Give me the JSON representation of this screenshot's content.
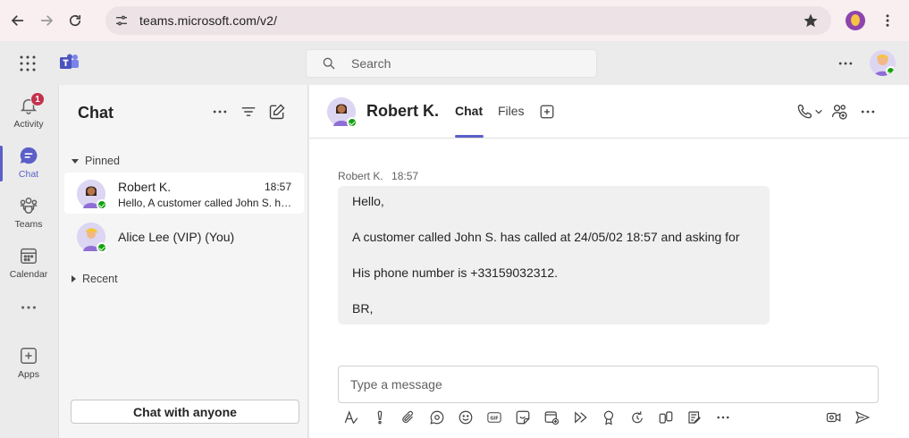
{
  "browser": {
    "url": "teams.microsoft.com/v2/"
  },
  "header": {
    "search_placeholder": "Search"
  },
  "rail": {
    "items": [
      {
        "label": "Activity",
        "badge": "1"
      },
      {
        "label": "Chat"
      },
      {
        "label": "Teams"
      },
      {
        "label": "Calendar"
      },
      {
        "label": "Apps"
      }
    ]
  },
  "chat_list": {
    "title": "Chat",
    "pinned_label": "Pinned",
    "recent_label": "Recent",
    "chats": [
      {
        "name": "Robert K.",
        "time": "18:57",
        "preview": "Hello, A customer called John S. has called at 24/05/02 18:57 and asking for"
      },
      {
        "name": "Alice Lee (VIP) (You)"
      }
    ],
    "chat_with_anyone": "Chat with anyone"
  },
  "conversation": {
    "name": "Robert K.",
    "tabs": [
      "Chat",
      "Files"
    ],
    "message": {
      "sender": "Robert K.",
      "time": "18:57",
      "lines": [
        "Hello,",
        "A customer called John S. has called at 24/05/02 18:57 and asking for",
        "His phone number is +33159032312.",
        "BR,"
      ]
    },
    "compose_placeholder": "Type a message"
  },
  "colors": {
    "accent": "#5b5fc7",
    "badge": "#c4314b",
    "presence": "#13a10e"
  }
}
